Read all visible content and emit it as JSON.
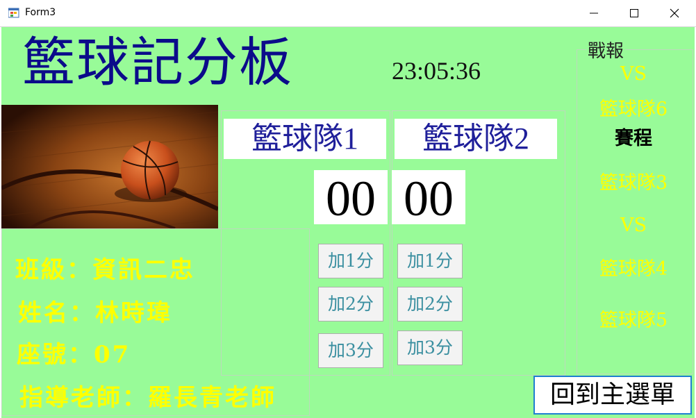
{
  "window": {
    "title": "Form3"
  },
  "header": {
    "title": "籃球記分板",
    "clock": "23:05:36"
  },
  "teams": [
    {
      "name": "籃球隊1",
      "score": "00",
      "buttons": [
        "加1分",
        "加2分",
        "加3分"
      ]
    },
    {
      "name": "籃球隊2",
      "score": "00",
      "buttons": [
        "加1分",
        "加2分",
        "加3分"
      ]
    }
  ],
  "info": {
    "class": "班級：資訊二忠",
    "name": "姓名：林時瑋",
    "seat": "座號：07",
    "teacher": "指導老師：羅長青老師"
  },
  "report": {
    "label": "戰報",
    "items": [
      "VS",
      "籃球隊6",
      "賽程",
      "籃球隊3",
      "VS",
      "籃球隊4",
      "籃球隊5"
    ]
  },
  "back_button": "回到主選單",
  "colors": {
    "background": "#98fb98",
    "title": "#0b0b8a",
    "info_text": "#ffff00",
    "team_name": "#1f1f9a"
  }
}
